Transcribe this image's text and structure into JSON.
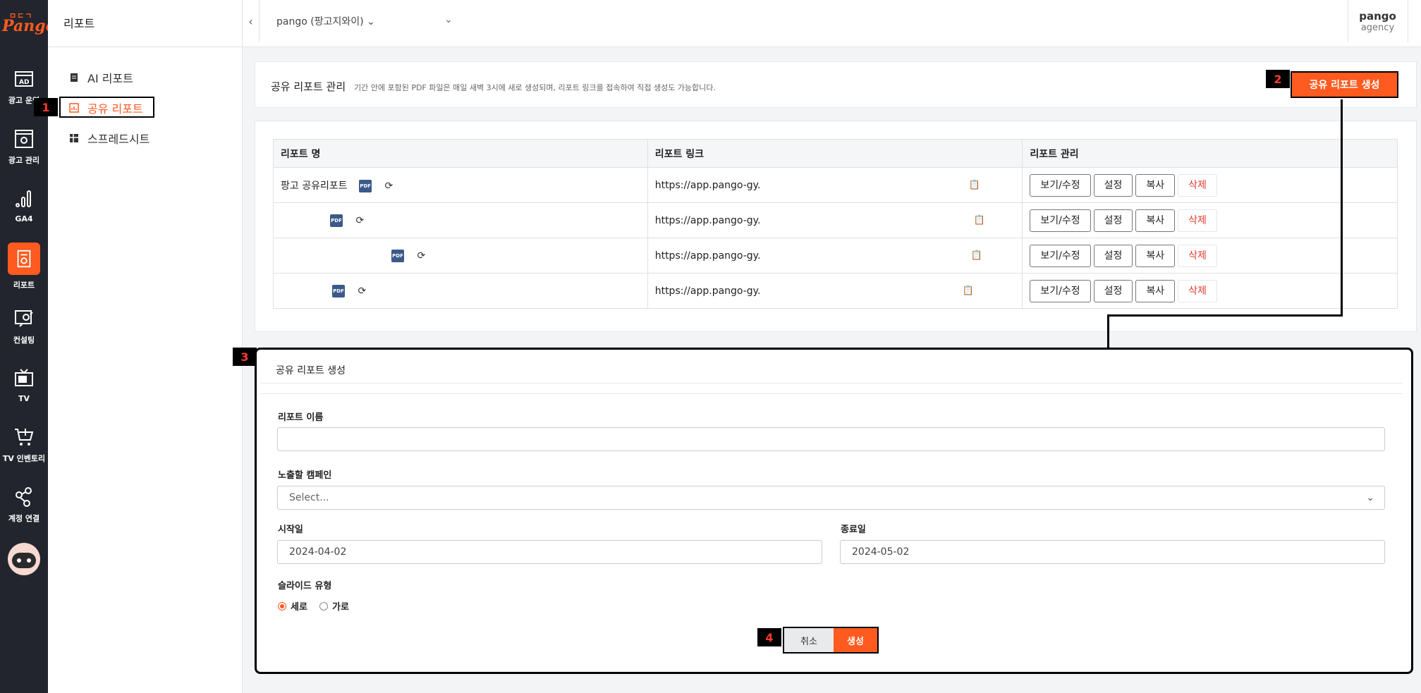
{
  "logo": {
    "top": "ㅁㄷㄱ",
    "main": "Pango"
  },
  "rail": [
    {
      "label": "광고 운영",
      "icon": "ad-icon"
    },
    {
      "label": "광고 관리",
      "icon": "ad-settings-icon"
    },
    {
      "label": "GA4",
      "icon": "analytics-icon"
    },
    {
      "label": "리포트",
      "icon": "report-icon"
    },
    {
      "label": "컨설팅",
      "icon": "consulting-icon"
    },
    {
      "label": "TV",
      "icon": "tv-icon"
    },
    {
      "label": "TV 인벤토리",
      "icon": "cart-icon"
    },
    {
      "label": "계정 연결",
      "icon": "link-icon"
    }
  ],
  "sidebar": {
    "title": "리포트",
    "items": [
      {
        "label": "AI 리포트",
        "icon": "document-icon"
      },
      {
        "label": "공유 리포트",
        "icon": "chart-icon"
      },
      {
        "label": "스프레드시트",
        "icon": "spreadsheet-icon"
      }
    ]
  },
  "topbar": {
    "account": "pango (팡고지와이) ⌄",
    "caret": "⌄",
    "collapse": "‹",
    "brand_name": "pango",
    "brand_sub": "agency"
  },
  "header": {
    "title": "공유 리포트 관리",
    "desc": "기간 안에 포함된 PDF 파일은 매일 새벽 3시에 새로 생성되며, 리포트 링크를 접속하여 직접 생성도 가능합니다.",
    "create_btn": "공유 리포트 생성"
  },
  "table": {
    "headers": [
      "리포트 명",
      "리포트 링크",
      "리포트 관리"
    ],
    "rows": [
      {
        "name": "팡고 공유리포트",
        "link": "https://app.pango-gy."
      },
      {
        "name": "",
        "link": "https://app.pango-gy."
      },
      {
        "name": "",
        "link": "https://app.pango-gy."
      },
      {
        "name": "",
        "link": "https://app.pango-gy."
      }
    ],
    "actions": {
      "view": "보기/수정",
      "settings": "설정",
      "copy": "복사",
      "delete": "삭제"
    },
    "pdf": "PDF",
    "refresh": "⟳",
    "clipboard": "📋"
  },
  "form": {
    "title": "공유 리포트 생성",
    "name_label": "리포트 이름",
    "name_value": "",
    "campaign_label": "노출할 캠페인",
    "campaign_placeholder": "Select...",
    "start_label": "시작일",
    "start_value": "2024-04-02",
    "end_label": "종료일",
    "end_value": "2024-05-02",
    "slide_label": "슬라이드 유형",
    "slide_options": [
      "세로",
      "가로"
    ],
    "cancel": "취소",
    "create": "생성"
  },
  "steps": [
    "1",
    "2",
    "3",
    "4"
  ],
  "colors": {
    "accent": "#ff5a1f",
    "rail_bg": "#22252d",
    "step_text": "#ff3b2f"
  }
}
